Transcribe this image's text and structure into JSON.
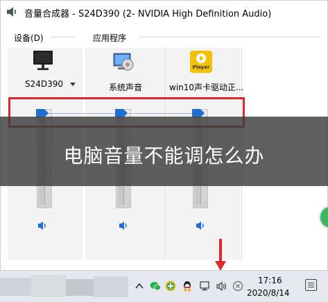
{
  "window": {
    "title": "音量合成器 - S24D390 (2- NVIDIA High Definition Audio)"
  },
  "groups": {
    "device_label": "设备(D)",
    "apps_label": "应用程序"
  },
  "channels": [
    {
      "name": "S24D390",
      "icon": "monitor-icon",
      "volume_pct": 100,
      "has_dropdown": true
    },
    {
      "name": "系统声音",
      "icon": "system-sounds-icon",
      "volume_pct": 100
    },
    {
      "name": "win10声卡驱动正...",
      "icon": "player-icon",
      "icon_label": "Player",
      "volume_pct": 100
    }
  ],
  "overlay": {
    "text": "电脑音量不能调怎么办"
  },
  "taskbar": {
    "time": "17:16",
    "date": "2020/8/14",
    "tray_icons": [
      "chevron-up-icon",
      "wechat-icon",
      "green-plus-icon",
      "qq-icon",
      "network-icon",
      "volume-icon",
      "close-circle-icon"
    ],
    "notification_icon": "notification-icon"
  },
  "colors": {
    "highlight_box": "#e2262b",
    "slider_thumb": "#1e6fd1",
    "overlay": "#3c3c3c",
    "arrow": "#e2262b"
  }
}
